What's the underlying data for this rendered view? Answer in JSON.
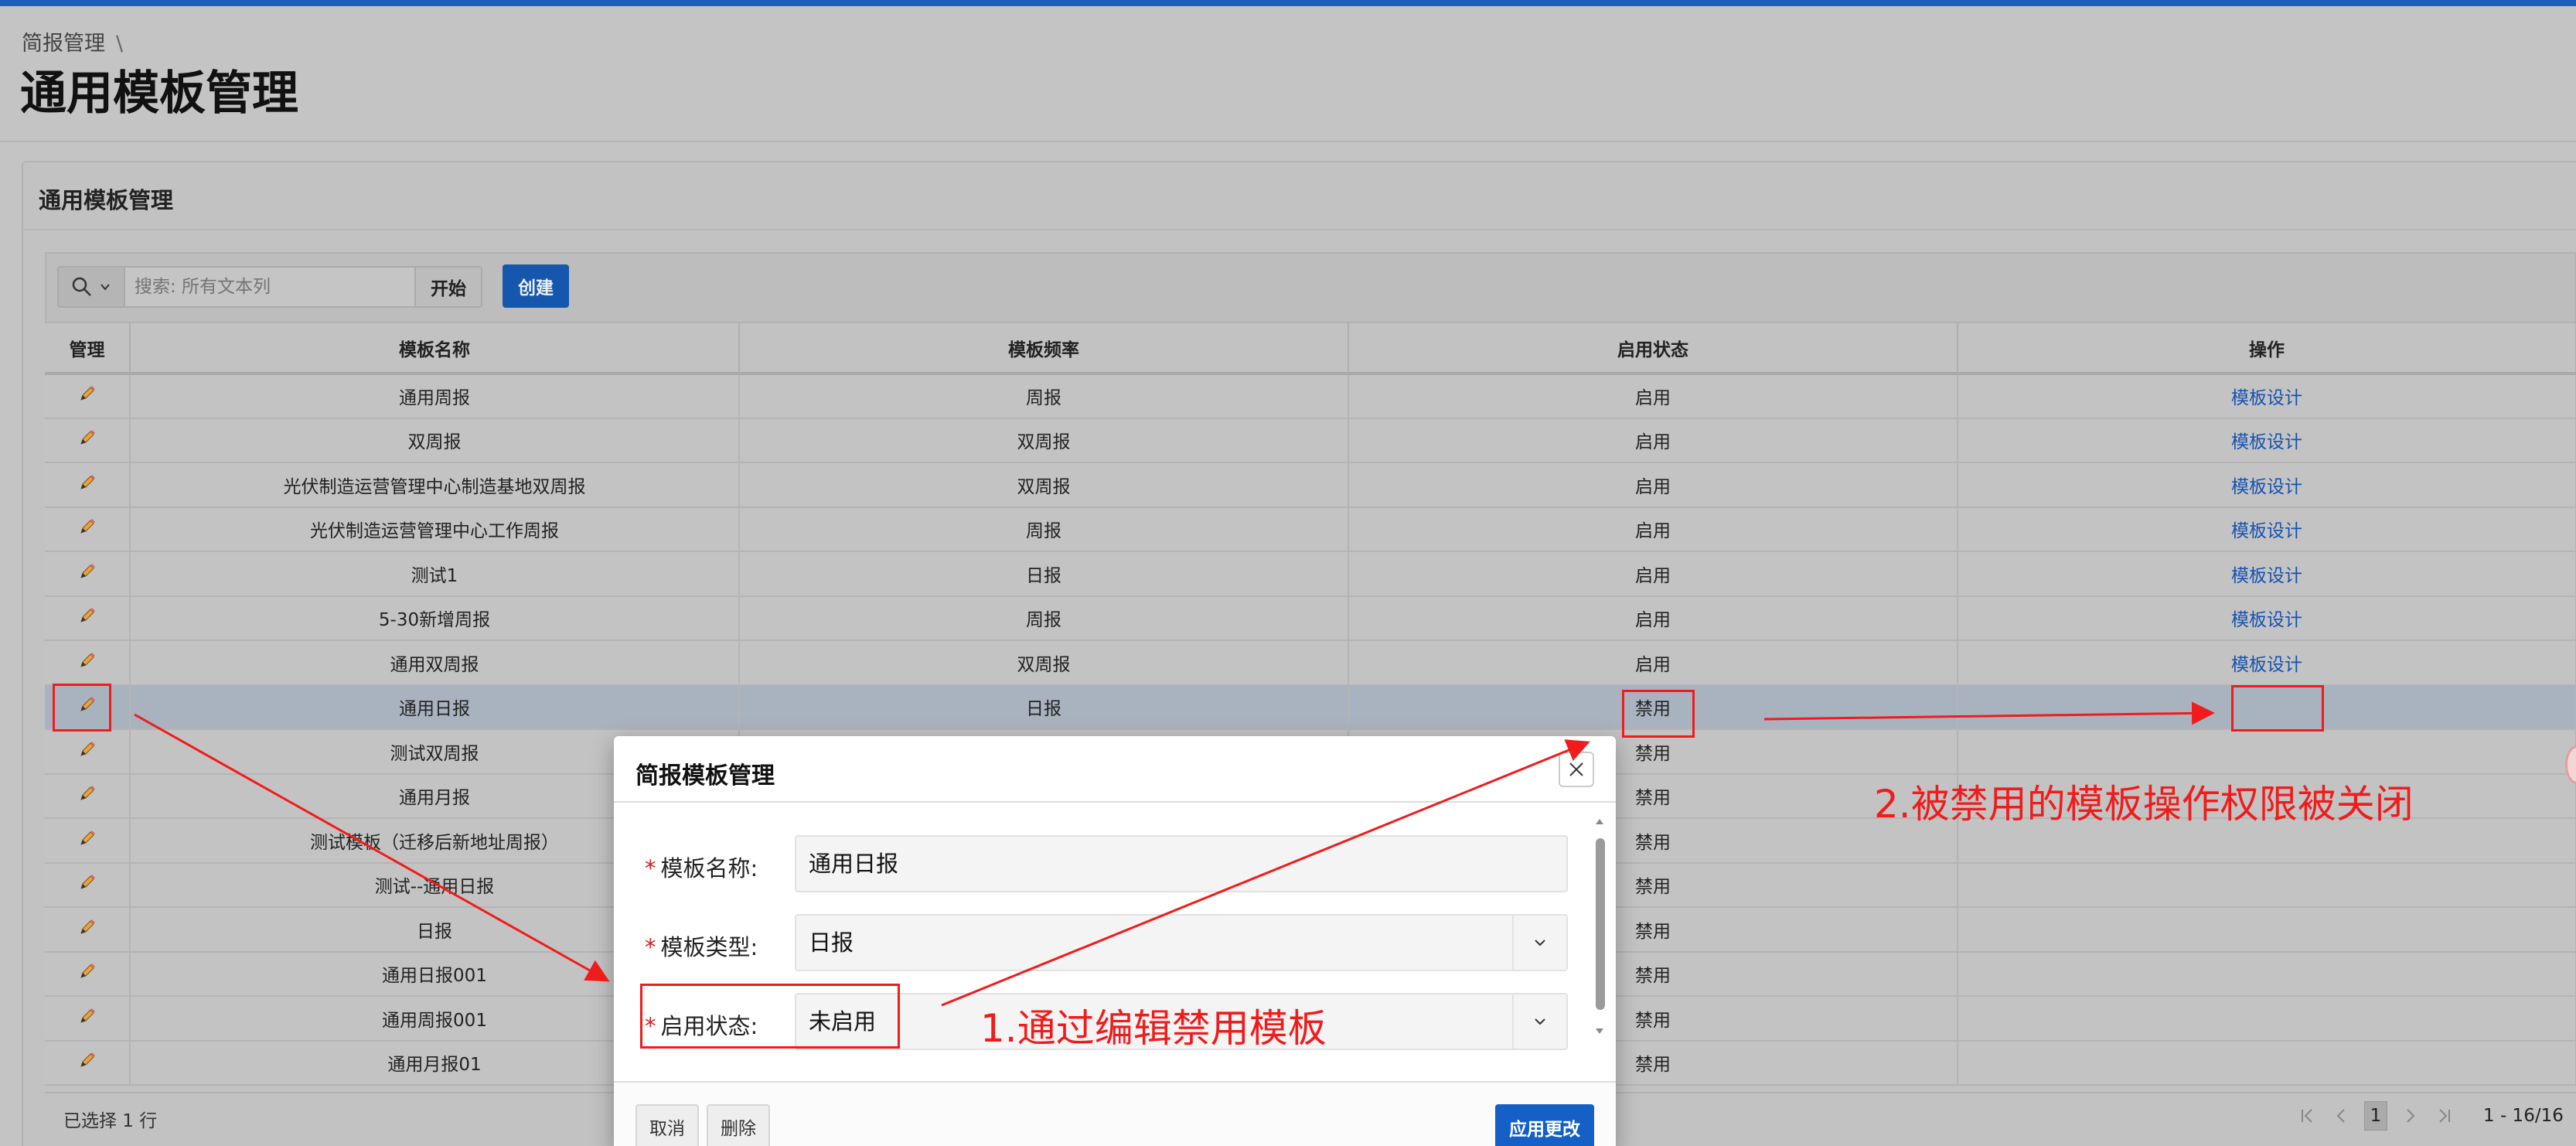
{
  "page": {
    "breadcrumb": "简报管理",
    "breadcrumb_sep": "\\",
    "title": "通用模板管理"
  },
  "region": {
    "title": "通用模板管理"
  },
  "toolbar": {
    "search_placeholder": "搜索: 所有文本列",
    "go_label": "开始",
    "create_label": "创建"
  },
  "table": {
    "headers": [
      "管理",
      "模板名称",
      "模板频率",
      "启用状态",
      "操作"
    ],
    "rows": [
      {
        "name": "通用周报",
        "freq": "周报",
        "status": "启用",
        "action": "模板设计"
      },
      {
        "name": "双周报",
        "freq": "双周报",
        "status": "启用",
        "action": "模板设计"
      },
      {
        "name": "光伏制造运营管理中心制造基地双周报",
        "freq": "双周报",
        "status": "启用",
        "action": "模板设计"
      },
      {
        "name": "光伏制造运营管理中心工作周报",
        "freq": "周报",
        "status": "启用",
        "action": "模板设计"
      },
      {
        "name": "测试1",
        "freq": "日报",
        "status": "启用",
        "action": "模板设计"
      },
      {
        "name": "5-30新增周报",
        "freq": "周报",
        "status": "启用",
        "action": "模板设计"
      },
      {
        "name": "通用双周报",
        "freq": "双周报",
        "status": "启用",
        "action": "模板设计"
      },
      {
        "name": "通用日报",
        "freq": "日报",
        "status": "禁用",
        "action": ""
      },
      {
        "name": "测试双周报",
        "freq": "",
        "status": "禁用",
        "action": ""
      },
      {
        "name": "通用月报",
        "freq": "",
        "status": "禁用",
        "action": ""
      },
      {
        "name": "测试模板（迁移后新地址周报）",
        "freq": "",
        "status": "禁用",
        "action": ""
      },
      {
        "name": "测试--通用日报",
        "freq": "",
        "status": "禁用",
        "action": ""
      },
      {
        "name": "日报",
        "freq": "",
        "status": "禁用",
        "action": ""
      },
      {
        "name": "通用日报001",
        "freq": "",
        "status": "禁用",
        "action": ""
      },
      {
        "name": "通用周报001",
        "freq": "",
        "status": "禁用",
        "action": ""
      },
      {
        "name": "通用月报01",
        "freq": "",
        "status": "禁用",
        "action": ""
      }
    ]
  },
  "footer": {
    "selected_text": "已选择 1 行",
    "current_page": "1",
    "range": "1 - 16/16"
  },
  "dialog": {
    "title": "简报模板管理",
    "fields": {
      "name_label": "模板名称:",
      "name_value": "通用日报",
      "type_label": "模板类型:",
      "type_value": "日报",
      "status_label": "启用状态:",
      "status_value": "未启用"
    },
    "cancel_label": "取消",
    "delete_label": "删除",
    "apply_label": "应用更改"
  },
  "annotations": {
    "step1": "1.通过编辑禁用模板",
    "step2": "2.被禁用的模板操作权限被关闭",
    "color": "#f01c1c"
  },
  "colors": {
    "accent": "#1557ad",
    "link": "#1652b0",
    "selected_row": "#a9b3bf"
  }
}
